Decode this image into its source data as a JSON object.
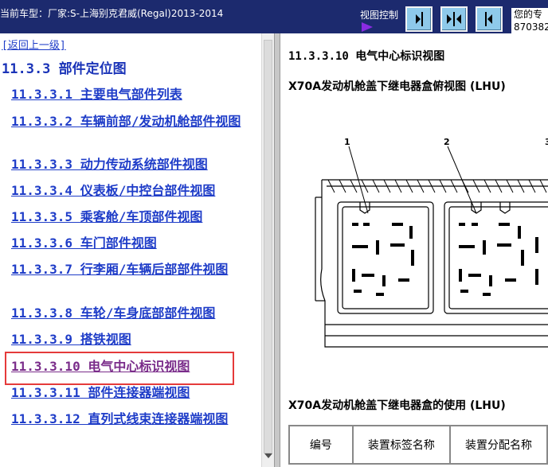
{
  "header": {
    "vehicle_label": "当前车型：厂家:S-上海别克君威(Regal)2013-2014",
    "view_control_label": "视图控制",
    "info_line1": "您的专",
    "info_line2": "870382"
  },
  "nav": {
    "back_link": "[返回上一级]",
    "section_title": "11.3.3 部件定位图",
    "items": [
      "11.3.3.1 主要电气部件列表",
      "11.3.3.2 车辆前部/发动机舱部件视图",
      "11.3.3.3 动力传动系统部件视图",
      "11.3.3.4 仪表板/中控台部件视图",
      "11.3.3.5 乘客舱/车顶部件视图",
      "11.3.3.6 车门部件视图",
      "11.3.3.7 行李厢/车辆后部部件视图",
      "11.3.3.8 车轮/车身底部部件视图",
      "11.3.3.9 搭铁视图",
      "11.3.3.10 电气中心标识视图",
      "11.3.3.11 部件连接器端视图",
      "11.3.3.12 直列式线束连接器端视图"
    ]
  },
  "content": {
    "heading": "11.3.3.10 电气中心标识视图",
    "top_view_title": "X70A发动机舱盖下继电器盒俯视图 (LHU)",
    "callouts": [
      "1",
      "2",
      "3"
    ],
    "usage_title": "X70A发动机舱盖下继电器盒的使用 (LHU)",
    "table_headers": [
      "编号",
      "装置标签名称",
      "装置分配名称"
    ]
  },
  "colors": {
    "topbar": "#1c2a6e",
    "link": "#1e3cc8",
    "visited_link": "#7a2c8a",
    "highlight": "#e53a3a",
    "button": "#8ec9ea"
  },
  "icons": {
    "view_control": "purple-arrow-icon",
    "buttons": [
      "collapse-left-icon",
      "split-view-icon",
      "collapse-right-icon"
    ]
  }
}
